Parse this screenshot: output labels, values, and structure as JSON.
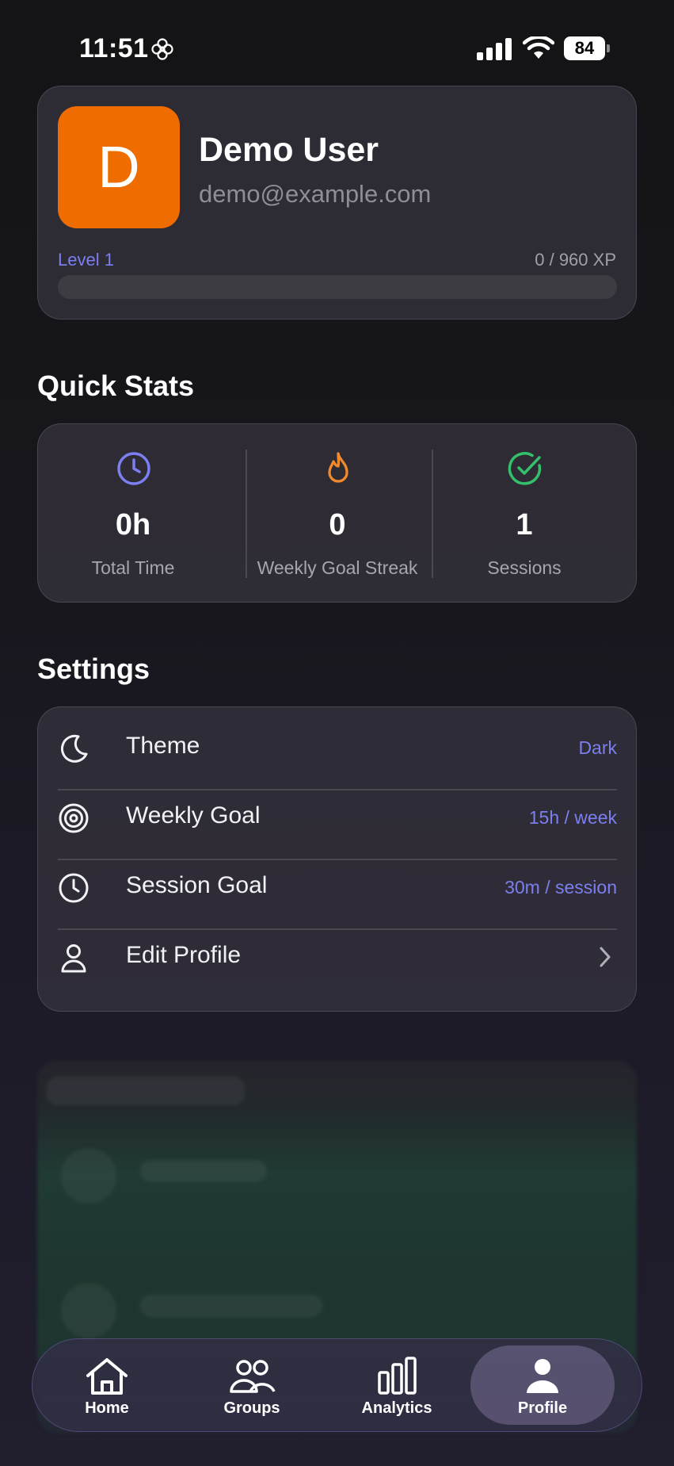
{
  "status_bar": {
    "time": "11:51",
    "battery": "84"
  },
  "profile": {
    "avatar_letter": "D",
    "name": "Demo User",
    "email": "demo@example.com",
    "level": "Level 1",
    "xp": "0 / 960 XP",
    "xp_progress": 0
  },
  "quick_stats": {
    "title": "Quick Stats",
    "items": [
      {
        "value": "0h",
        "label": "Total Time",
        "icon": "clock-icon",
        "color": "#7b7ff0"
      },
      {
        "value": "0",
        "label": "Weekly Goal Streak",
        "icon": "flame-icon",
        "color": "#f08a2c"
      },
      {
        "value": "1",
        "label": "Sessions",
        "icon": "check-circle-icon",
        "color": "#34c06a"
      }
    ]
  },
  "settings": {
    "title": "Settings",
    "rows": [
      {
        "label": "Theme",
        "value": "Dark",
        "icon": "moon-icon"
      },
      {
        "label": "Weekly Goal",
        "value": "15h / week",
        "icon": "target-icon"
      },
      {
        "label": "Session Goal",
        "value": "30m / session",
        "icon": "clock-icon"
      },
      {
        "label": "Edit Profile",
        "value": "",
        "icon": "user-icon"
      }
    ]
  },
  "tab_bar": {
    "tabs": [
      {
        "label": "Home",
        "icon": "home-icon"
      },
      {
        "label": "Groups",
        "icon": "groups-icon"
      },
      {
        "label": "Analytics",
        "icon": "bar-chart-icon"
      },
      {
        "label": "Profile",
        "icon": "person-icon",
        "active": true
      }
    ]
  },
  "colors": {
    "accent": "#7b7ff0",
    "avatar": "#ef6c00",
    "streak": "#f08a2c",
    "success": "#34c06a"
  }
}
